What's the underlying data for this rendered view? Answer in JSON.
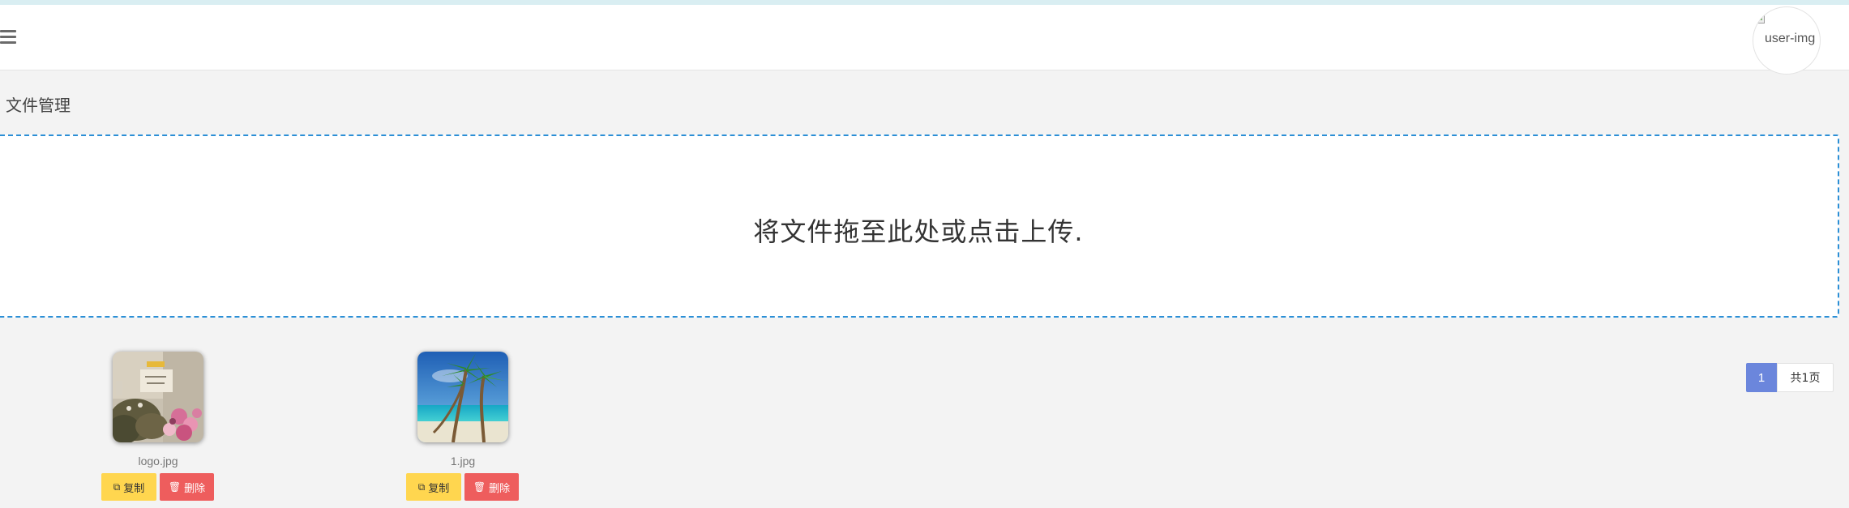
{
  "header": {
    "menu_icon": "hamburger-menu-icon",
    "avatar_alt": "user-img"
  },
  "page": {
    "title": "文件管理"
  },
  "dropzone": {
    "message": "将文件拖至此处或点击上传."
  },
  "files": [
    {
      "name": "logo.jpg",
      "copy_label": "复制",
      "delete_label": "删除",
      "copy_icon": "copy-icon",
      "delete_icon": "trash-icon"
    },
    {
      "name": "1.jpg",
      "copy_label": "复制",
      "delete_label": "删除",
      "copy_icon": "copy-icon",
      "delete_icon": "trash-icon"
    }
  ],
  "pagination": {
    "current": "1",
    "total": "共1页"
  },
  "colors": {
    "dropzone_border": "#2b8fd6",
    "copy_button": "#ffd64f",
    "delete_button": "#ee5d5d",
    "pager_active": "#6b86dc"
  }
}
